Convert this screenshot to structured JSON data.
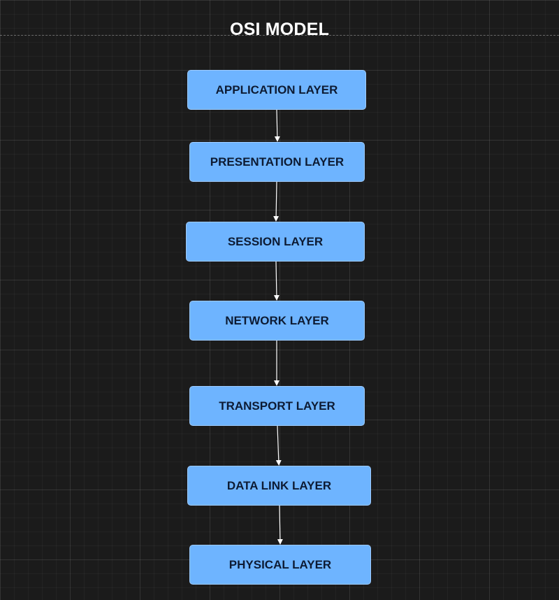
{
  "diagram": {
    "title": "OSI MODEL",
    "colors": {
      "background": "#1b1b1b",
      "node_fill": "#6eb4ff",
      "node_text": "#0d1b33",
      "connector": "#ffffff"
    },
    "nodes": [
      {
        "label": "APPLICATION LAYER"
      },
      {
        "label": "PRESENTATION LAYER"
      },
      {
        "label": "SESSION LAYER"
      },
      {
        "label": "NETWORK LAYER"
      },
      {
        "label": "TRANSPORT LAYER"
      },
      {
        "label": "DATA LINK LAYER"
      },
      {
        "label": "PHYSICAL LAYER"
      }
    ]
  }
}
